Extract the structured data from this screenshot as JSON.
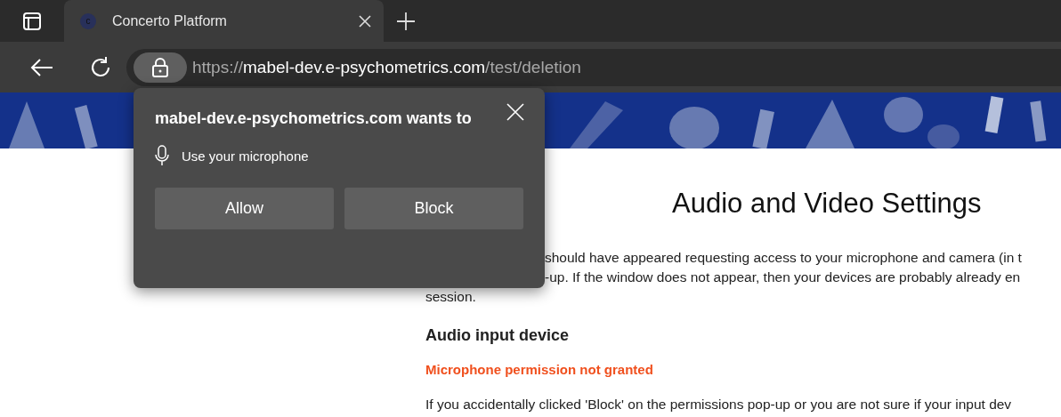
{
  "tabs": [
    {
      "title": "Concerto Platform",
      "favicon": "c",
      "selected": true
    }
  ],
  "address_bar": {
    "scheme": "https://",
    "host": "mabel-dev.e-psychometrics.com",
    "path": "/test/deletion"
  },
  "page": {
    "heading": "Audio and Video Settings",
    "intro_lines": [
      {
        "text": "should have appeared requesting access to your microphone and camera (in t",
        "covered": true
      },
      {
        "text": "-up. If the window does not appear, then your devices are probably already en",
        "covered": true
      },
      {
        "text": "session.",
        "covered": false
      }
    ],
    "section_heading": "Audio input device",
    "error": "Microphone permission not granted",
    "help": "If you accidentally clicked 'Block' on the permissions pop-up or you are not sure if your input dev"
  },
  "permission_popup": {
    "title": "mabel-dev.e-psychometrics.com wants to",
    "request": "Use your microphone",
    "buttons": [
      "Allow",
      "Block"
    ]
  }
}
